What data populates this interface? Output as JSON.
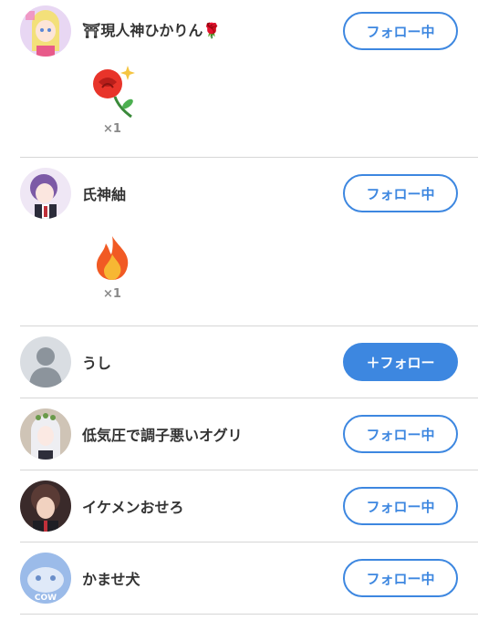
{
  "users": [
    {
      "name": "⛩現人神ひかりん🌹",
      "button": "フォロー中",
      "state": "following",
      "avatar_color": "#c9a6e8"
    },
    {
      "name": "氏神紬",
      "button": "フォロー中",
      "state": "following",
      "avatar_color": "#7c5aa6"
    },
    {
      "name": "うし",
      "button": "＋フォロー",
      "state": "follow",
      "avatar_color": "#c3c9d0"
    },
    {
      "name": "低気圧で調子悪いオグリ",
      "button": "フォロー中",
      "state": "following",
      "avatar_color": "#b9a89a"
    },
    {
      "name": "イケメンおせろ",
      "button": "フォロー中",
      "state": "following",
      "avatar_color": "#5a3b35"
    },
    {
      "name": "かませ犬",
      "button": "フォロー中",
      "state": "following",
      "avatar_color": "#9bbbe9"
    }
  ],
  "gifts": [
    {
      "icon": "rose-emoji-icon",
      "count": "×1"
    },
    {
      "icon": "fire-emoji-icon",
      "count": "×1"
    }
  ],
  "colors": {
    "accent": "#3d87e0",
    "divider": "#d6d6d6"
  },
  "avatar_text": "COW"
}
